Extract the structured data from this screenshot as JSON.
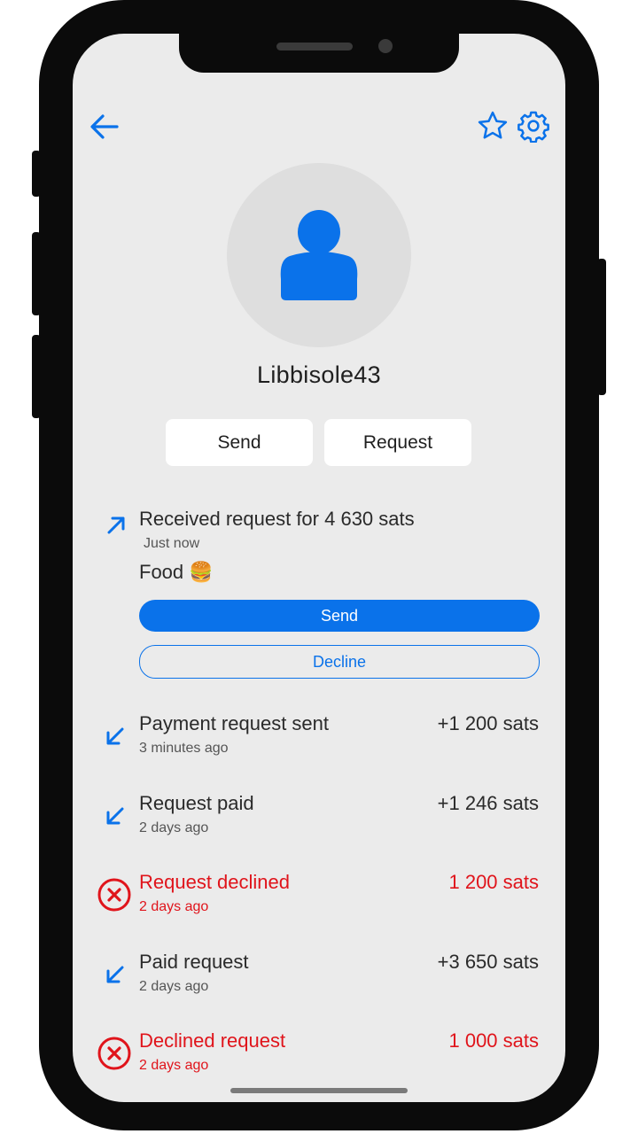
{
  "profile": {
    "username": "Libbisole43"
  },
  "actions": {
    "send_label": "Send",
    "request_label": "Request"
  },
  "pending_request": {
    "title": "Received request for 4 630 sats",
    "time": "Just now",
    "note": "Food 🍔",
    "send_label": "Send",
    "decline_label": "Decline"
  },
  "transactions": [
    {
      "title": "Payment request sent",
      "time": "3 minutes ago",
      "amount": "+1 200 sats",
      "icon": "arrow-down-left-icon"
    },
    {
      "title": "Request paid",
      "time": "2 days ago",
      "amount": "+1 246 sats",
      "icon": "arrow-down-left-icon"
    },
    {
      "title": "Request declined",
      "time": "2 days ago",
      "amount": "1 200 sats",
      "icon": "declined-x-icon"
    },
    {
      "title": "Paid request",
      "time": "2 days ago",
      "amount": "+3 650 sats",
      "icon": "arrow-down-left-icon"
    },
    {
      "title": "Declined request",
      "time": "2 days ago",
      "amount": "1 000 sats",
      "icon": "declined-x-icon"
    }
  ],
  "colors": {
    "accent": "#0a72ea",
    "declined": "#e0141b",
    "background": "#ebebeb"
  }
}
